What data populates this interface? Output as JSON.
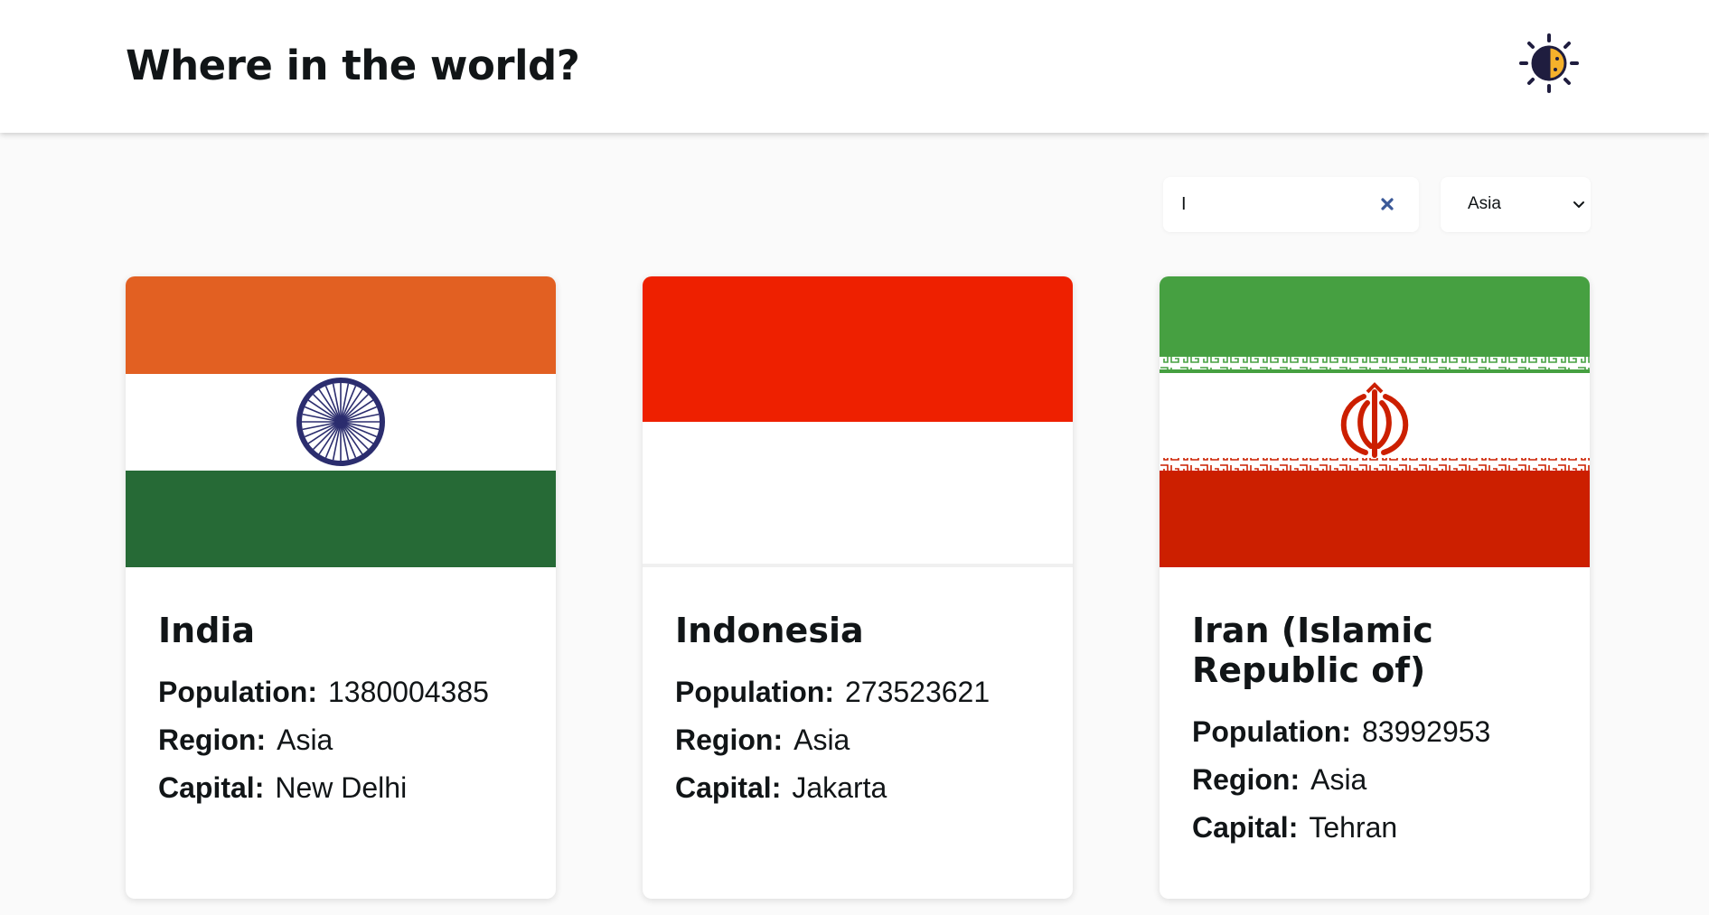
{
  "header": {
    "title": "Where in the world?",
    "theme_toggle_icon": "sun-moon-icon"
  },
  "filters": {
    "search_value": "I",
    "clear_icon": "close-icon",
    "region_selected": "Asia",
    "region_chevron_icon": "chevron-down-icon"
  },
  "labels": {
    "population": "Population:",
    "region": "Region:",
    "capital": "Capital:"
  },
  "countries": [
    {
      "name": "India",
      "population": "1380004385",
      "region": "Asia",
      "capital": "New Delhi",
      "flag": "india-flag"
    },
    {
      "name": "Indonesia",
      "population": "273523621",
      "region": "Asia",
      "capital": "Jakarta",
      "flag": "indonesia-flag"
    },
    {
      "name": "Iran (Islamic Republic of)",
      "population": "83992953",
      "region": "Asia",
      "capital": "Tehran",
      "flag": "iran-flag"
    }
  ],
  "colors": {
    "background": "#fafafa",
    "surface": "#ffffff",
    "text": "#111517",
    "india_saffron": "#e26022",
    "india_green": "#266a36",
    "india_chakra": "#2b2d6e",
    "indonesia_red": "#ee2000",
    "iran_green": "#46a041",
    "iran_red": "#cc1f00"
  }
}
